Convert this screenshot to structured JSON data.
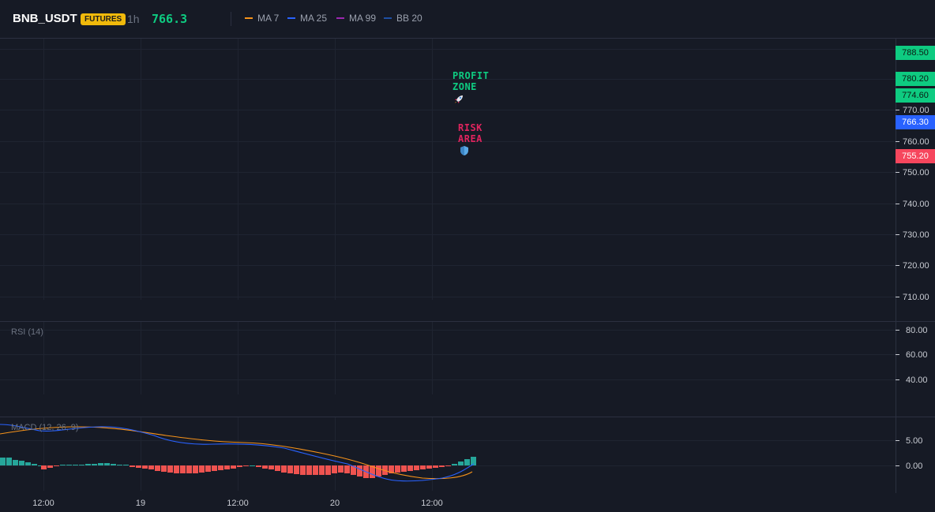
{
  "header": {
    "symbol": "BNB_USDT",
    "badge": "FUTURES",
    "timeframe": "1h",
    "price": "766.3",
    "indicators": [
      {
        "label": "MA 7",
        "color": "#f7931a"
      },
      {
        "label": "MA 25",
        "color": "#2962ff"
      },
      {
        "label": "MA 99",
        "color": "#9c27b0"
      },
      {
        "label": "BB 20",
        "color": "#1e4fa3"
      }
    ]
  },
  "price_axis": {
    "ticks": [
      "770.00",
      "760.00",
      "750.00",
      "740.00",
      "730.00",
      "720.00",
      "710.00"
    ],
    "tags": [
      {
        "label": "788.50",
        "bg": "#0ecb81",
        "fg": "#0b1a12"
      },
      {
        "label": "780.20",
        "bg": "#0ecb81",
        "fg": "#0b1a12"
      },
      {
        "label": "774.60",
        "bg": "#0ecb81",
        "fg": "#0b1a12"
      },
      {
        "label": "766.30",
        "bg": "#2962ff",
        "fg": "#ffffff"
      },
      {
        "label": "755.20",
        "bg": "#f6465d",
        "fg": "#ffffff"
      }
    ]
  },
  "annotations": {
    "profit": {
      "line1": "PROFIT",
      "line2": "ZONE",
      "color": "#0ecb81",
      "icon": "rocket-icon"
    },
    "risk": {
      "line1": "RISK",
      "line2": "AREA",
      "color": "#e0245e",
      "icon": "shield-icon"
    }
  },
  "rsi": {
    "title": "RSI (14)",
    "ticks": [
      "80.00",
      "60.00",
      "40.00"
    ]
  },
  "macd": {
    "title": "MACD (12, 26, 9)",
    "ticks": [
      "5.00",
      "0.00"
    ]
  },
  "time_axis": {
    "labels": [
      "12:00",
      "19",
      "12:00",
      "20",
      "12:00"
    ]
  }
}
